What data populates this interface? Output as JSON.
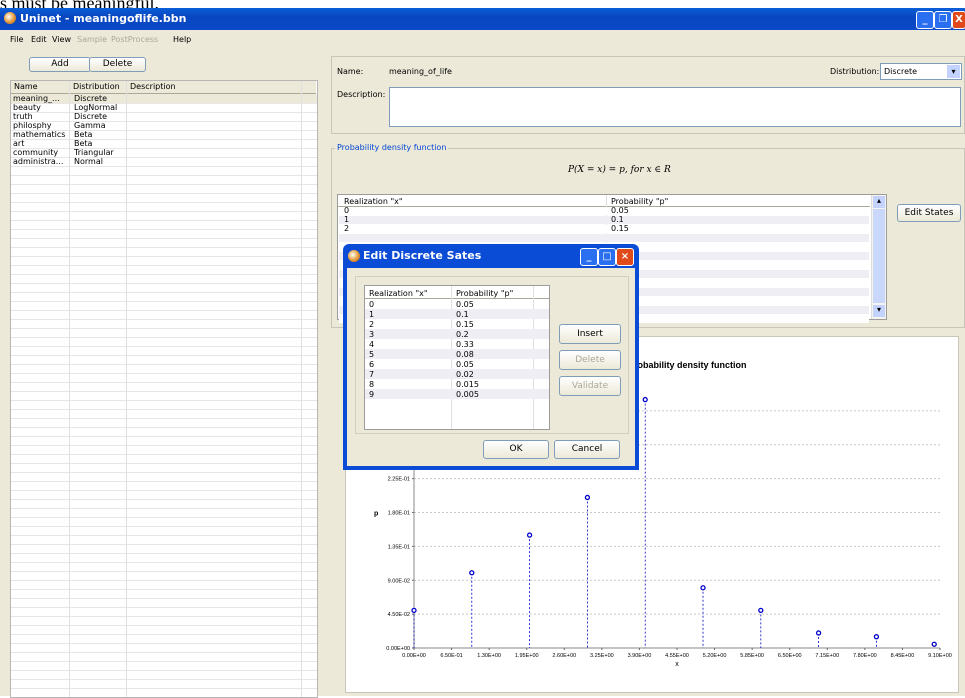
{
  "doc_text": "s must be meaningful.",
  "window": {
    "title": "Uninet - meaningoflife.bbn",
    "min": "_",
    "max": "❐",
    "close": "X"
  },
  "menu": [
    {
      "label": "File",
      "enabled": true
    },
    {
      "label": "Edit",
      "enabled": true
    },
    {
      "label": "View",
      "enabled": true
    },
    {
      "label": "Sample",
      "enabled": false
    },
    {
      "label": "PostProcess",
      "enabled": false
    },
    {
      "label": "Help",
      "enabled": true
    }
  ],
  "left": {
    "add_label": "Add",
    "delete_label": "Delete",
    "columns": [
      "Name",
      "Distribution",
      "Description"
    ],
    "rows": [
      {
        "name": "meaning_...",
        "dist": "Discrete"
      },
      {
        "name": "beauty",
        "dist": "LogNormal"
      },
      {
        "name": "truth",
        "dist": "Discrete"
      },
      {
        "name": "philosphy",
        "dist": "Gamma"
      },
      {
        "name": "mathematics",
        "dist": "Beta"
      },
      {
        "name": "art",
        "dist": "Beta"
      },
      {
        "name": "community",
        "dist": "Triangular"
      },
      {
        "name": "administra...",
        "dist": "Normal"
      }
    ]
  },
  "node": {
    "name_label": "Name:",
    "name_value": "meaning_of_life",
    "distribution_label": "Distribution:",
    "distribution_value": "Discrete",
    "description_label": "Description:",
    "pdf_group_label": "Probability density function",
    "formula": "P(X = x) = p, for x ∈ R",
    "edit_states_label": "Edit States",
    "col_x": "Realization \"x\"",
    "col_p": "Probability \"p\"",
    "states_visible": [
      {
        "x": "0",
        "p": "0.05"
      },
      {
        "x": "1",
        "p": "0.1"
      },
      {
        "x": "2",
        "p": "0.15"
      }
    ]
  },
  "dialog": {
    "title": "Edit Discrete Sates",
    "col_x": "Realization \"x\"",
    "col_p": "Probability \"p\"",
    "rows": [
      {
        "x": "0",
        "p": "0.05"
      },
      {
        "x": "1",
        "p": "0.1"
      },
      {
        "x": "2",
        "p": "0.15"
      },
      {
        "x": "3",
        "p": "0.2"
      },
      {
        "x": "4",
        "p": "0.33"
      },
      {
        "x": "5",
        "p": "0.08"
      },
      {
        "x": "6",
        "p": "0.05"
      },
      {
        "x": "7",
        "p": "0.02"
      },
      {
        "x": "8",
        "p": "0.015"
      },
      {
        "x": "9",
        "p": "0.005"
      }
    ],
    "insert_label": "Insert",
    "delete_label": "Delete",
    "validate_label": "Validate",
    "ok_label": "OK",
    "cancel_label": "Cancel"
  },
  "chart_data": {
    "type": "scatter",
    "title": "Probability density function",
    "title_visible": "robability density function",
    "xlabel": "x",
    "ylabel": "p",
    "x": [
      0,
      1,
      2,
      3,
      4,
      5,
      6,
      7,
      8,
      9
    ],
    "y": [
      0.05,
      0.1,
      0.15,
      0.2,
      0.33,
      0.08,
      0.05,
      0.02,
      0.015,
      0.005
    ],
    "xlim": [
      0,
      9.1
    ],
    "ylim": [
      0,
      0.36
    ],
    "xticks": [
      "0.00E+00",
      "6.50E-01",
      "1.30E+00",
      "1.95E+00",
      "2.60E+00",
      "3.25E+00",
      "3.90E+00",
      "4.55E+00",
      "5.20E+00",
      "5.85E+00",
      "6.50E+00",
      "7.15E+00",
      "7.80E+00",
      "8.45E+00",
      "9.10E+00"
    ],
    "yticks": [
      "0.00E+00",
      "4.50E-02",
      "9.00E-02",
      "1.35E-01",
      "1.80E-01",
      "2.25E-01"
    ],
    "ytick_values": [
      0,
      0.045,
      0.09,
      0.135,
      0.18,
      0.225
    ],
    "grid": true,
    "stem_style": "dashed",
    "color": "#0000cc"
  }
}
